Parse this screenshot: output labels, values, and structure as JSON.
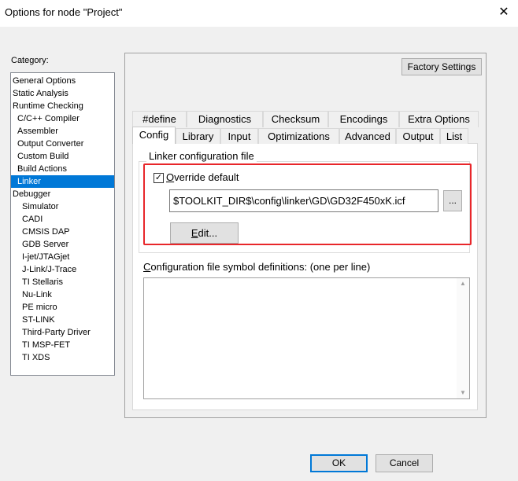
{
  "window": {
    "title": "Options for node \"Project\"",
    "close_glyph": "✕"
  },
  "category": {
    "label": "Category:",
    "items": [
      "General Options",
      "Static Analysis",
      "Runtime Checking",
      "C/C++ Compiler",
      "Assembler",
      "Output Converter",
      "Custom Build",
      "Build Actions",
      "Linker",
      "Debugger",
      "Simulator",
      "CADI",
      "CMSIS DAP",
      "GDB Server",
      "I-jet/JTAGjet",
      "J-Link/J-Trace",
      "TI Stellaris",
      "Nu-Link",
      "PE micro",
      "ST-LINK",
      "Third-Party Driver",
      "TI MSP-FET",
      "TI XDS"
    ],
    "selected": "Linker"
  },
  "factory_settings_label": "Factory Settings",
  "tabs_row1": [
    "#define",
    "Diagnostics",
    "Checksum",
    "Encodings",
    "Extra Options"
  ],
  "tabs_row2": [
    "Config",
    "Library",
    "Input",
    "Optimizations",
    "Advanced",
    "Output",
    "List"
  ],
  "active_tab": "Config",
  "linker_config": {
    "group_label": "Linker configuration file",
    "override_label_first": "O",
    "override_label_rest": "verride default",
    "override_checked": true,
    "path_value": "$TOOLKIT_DIR$\\config\\linker\\GD\\GD32F450xK.icf",
    "browse_label": "...",
    "edit_label_first": "E",
    "edit_label_rest": "dit..."
  },
  "symbols": {
    "label_first": "C",
    "label_rest": "onfiguration file symbol definitions: (one per line)",
    "value": ""
  },
  "buttons": {
    "ok": "OK",
    "cancel": "Cancel"
  },
  "colors": {
    "selection": "#0078d7",
    "highlight_box": "#e8262a"
  }
}
